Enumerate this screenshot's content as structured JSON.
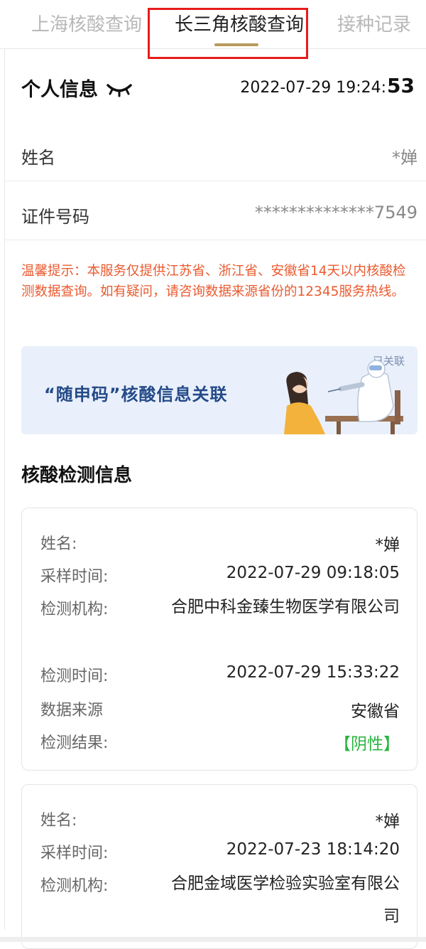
{
  "tabs": [
    {
      "label": "上海核酸查询"
    },
    {
      "label": "长三角核酸查询"
    },
    {
      "label": "接种记录"
    }
  ],
  "personal": {
    "title": "个人信息",
    "datetime_main": "2022-07-29 19:24:",
    "datetime_sec": "53",
    "name_label": "姓名",
    "name_value": "*婵",
    "id_label": "证件号码",
    "id_value": "**************7549"
  },
  "notice": "温馨提示：本服务仅提供江苏省、浙江省、安徽省14天以内核酸检测数据查询。如有疑问，请咨询数据来源省份的12345服务热线。",
  "banner": {
    "text": "“随申码”核酸信息关联",
    "tag": "已关联"
  },
  "section_title": "核酸检测信息",
  "records": [
    {
      "name_label": "姓名:",
      "name": "*婵",
      "sample_label": "采样时间:",
      "sample_time": "2022-07-29 09:18:05",
      "org_label": "检测机构:",
      "org": "合肥中科金臻生物医学有限公司",
      "test_label": "检测时间:",
      "test_time": "2022-07-29 15:33:22",
      "source_label": "数据来源",
      "source": "安徽省",
      "result_label": "检测结果:",
      "result": "【阴性】"
    },
    {
      "name_label": "姓名:",
      "name": "*婵",
      "sample_label": "采样时间:",
      "sample_time": "2022-07-23 18:14:20",
      "org_label": "检测机构:",
      "org": "合肥金域医学检验实验室有限公司"
    }
  ],
  "colors": {
    "accent_gold": "#b89a5d",
    "highlight_red": "#e81c1c",
    "notice_orange": "#ea5a2f",
    "negative_green": "#2ab43f",
    "banner_bg": "#e9f0fb"
  }
}
